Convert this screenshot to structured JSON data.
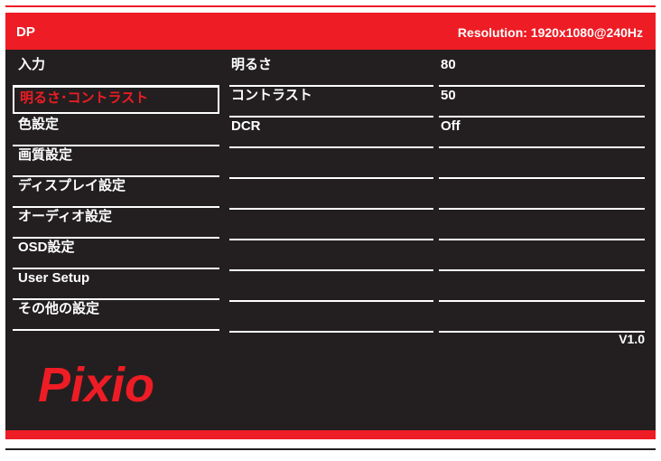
{
  "header": {
    "source": "DP",
    "resolution": "Resolution:  1920x1080@240Hz"
  },
  "menu": {
    "items": [
      {
        "label": "入力"
      },
      {
        "label": "明るさ･コントラスト"
      },
      {
        "label": "色設定"
      },
      {
        "label": "画質設定"
      },
      {
        "label": "ディスプレイ設定"
      },
      {
        "label": "オーディオ設定"
      },
      {
        "label": "OSD設定"
      },
      {
        "label": "User Setup"
      },
      {
        "label": "その他の設定"
      }
    ],
    "selected": "明るさ･コントラスト"
  },
  "submenu": {
    "items": [
      {
        "label": "明るさ",
        "value": "80"
      },
      {
        "label": "コントラスト",
        "value": "50"
      },
      {
        "label": "DCR",
        "value": "Off"
      }
    ]
  },
  "footer": {
    "version": "V1.0",
    "brand": "Pixio"
  },
  "colors": {
    "accent": "#ee1c25",
    "background": "#231f20",
    "text": "#ffffff"
  }
}
